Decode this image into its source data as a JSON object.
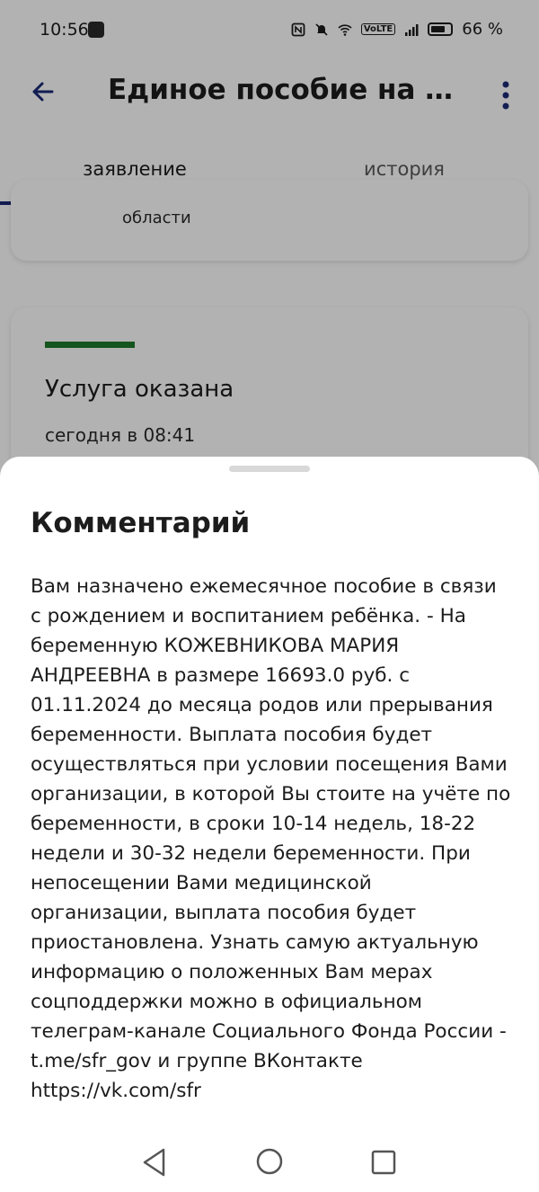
{
  "status_bar": {
    "time": "10:56",
    "battery": "66 %",
    "network_badge": "VoLTE"
  },
  "app_bar": {
    "title": "Единое пособие на де..."
  },
  "tabs": [
    {
      "label": "заявление",
      "active": true
    },
    {
      "label": "история",
      "active": false
    }
  ],
  "background": {
    "card_text": "области",
    "status_title": "Услуга оказана",
    "status_time": "сегодня в 08:41",
    "status_color": "#1f7a2c"
  },
  "sheet": {
    "title": "Комментарий",
    "body": "Вам назначено ежемесячное пособие в связи с рождением и воспитанием ребёнка. - На беременную КОЖЕВНИКОВА МАРИЯ АНДРЕЕВНА в размере 16693.0 руб. с 01.11.2024 до месяца родов или прерывания беременности. Выплата пособия будет осуществляться при условии посещения Вами организации, в которой Вы стоите на учёте по беременности, в сроки 10-14 недель, 18-22 недели и 30-32 недели беременности. При непосещении Вами медицинской организации, выплата пособия будет приостановлена. Узнать самую актуальную информацию о положенных Вам мерах соцподдержки можно в официальном телеграм-канале Социального Фонда России - t.me/sfr_gov и группе ВКонтакте https://vk.com/sfr"
  },
  "colors": {
    "accent": "#1b2a78",
    "overlay": "rgba(0,0,0,0.30)"
  },
  "icons": [
    "back-arrow-icon",
    "more-vert-icon",
    "nfc-icon",
    "mute-icon",
    "wifi-icon",
    "signal-icon",
    "battery-icon",
    "nav-back-icon",
    "nav-home-icon",
    "nav-recent-icon"
  ]
}
